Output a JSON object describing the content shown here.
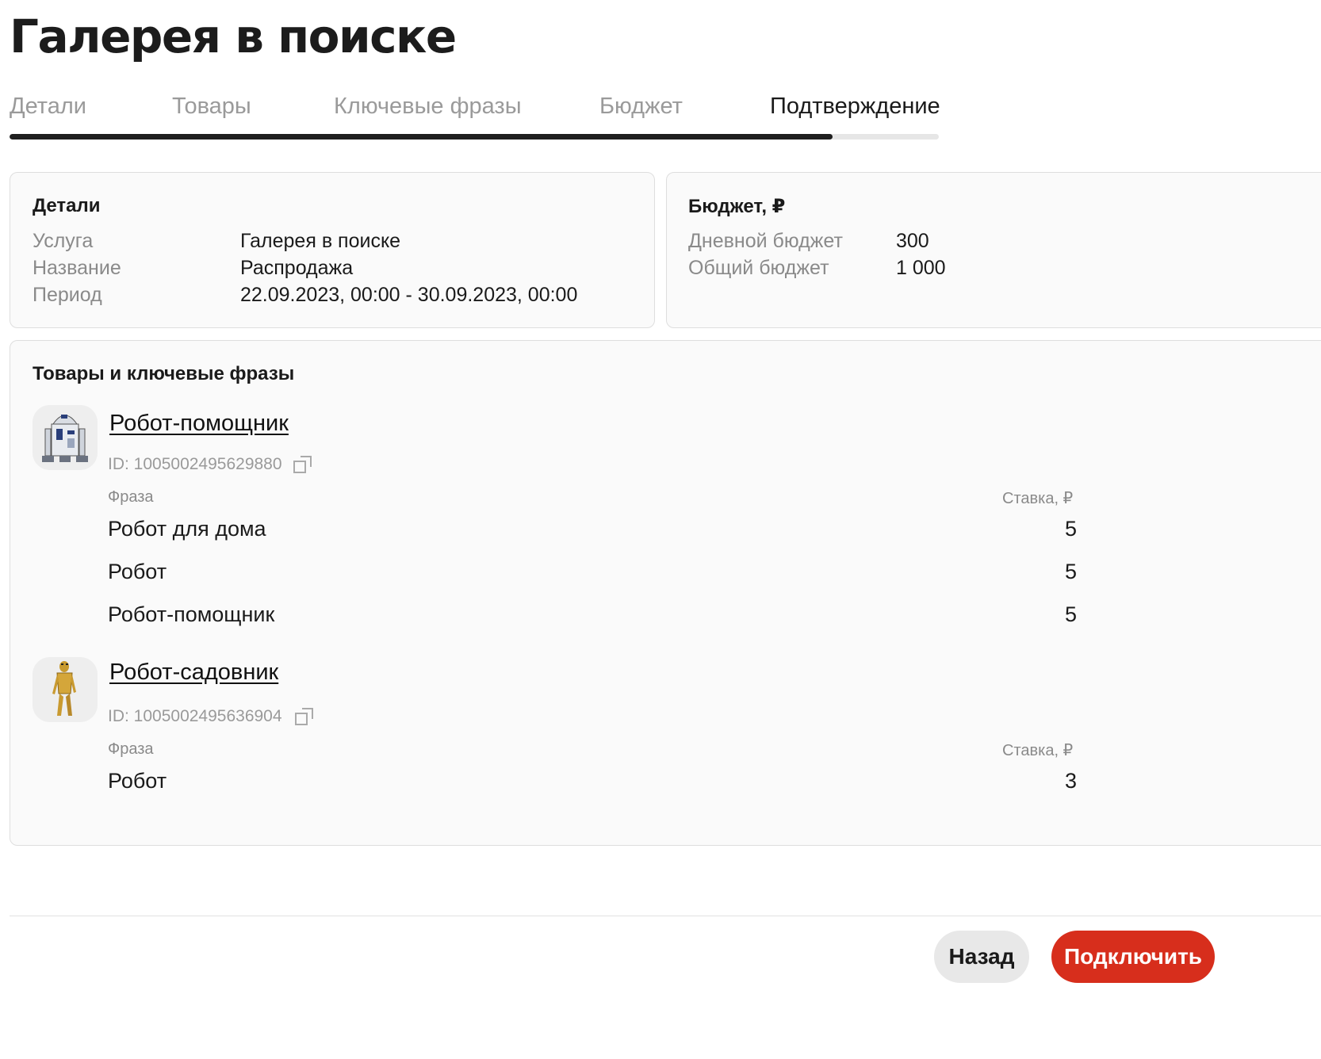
{
  "page": {
    "title": "Галерея в поиске"
  },
  "steps": {
    "items": [
      {
        "label": "Детали"
      },
      {
        "label": "Товары"
      },
      {
        "label": "Ключевые фразы"
      },
      {
        "label": "Бюджет"
      },
      {
        "label": "Подтверждение"
      }
    ],
    "active_index": 4,
    "progress_fraction": 0.886
  },
  "details": {
    "title": "Детали",
    "rows": [
      {
        "label": "Услуга",
        "value": "Галерея в поиске"
      },
      {
        "label": "Название",
        "value": "Распродажа"
      },
      {
        "label": "Период",
        "value": "22.09.2023, 00:00 - 30.09.2023, 00:00"
      }
    ]
  },
  "budget": {
    "title": "Бюджет, ₽",
    "rows": [
      {
        "label": "Дневной бюджет",
        "value": "300"
      },
      {
        "label": "Общий бюджет",
        "value": "1 000"
      }
    ]
  },
  "products": {
    "title": "Товары и ключевые фразы",
    "phrase_header": "Фраза",
    "bid_header": "Ставка, ₽",
    "items": [
      {
        "name": "Робот-помощник",
        "id_text": "ID: 1005002495629880",
        "image_icon": "r2d2-robot-image",
        "phrases": [
          {
            "phrase": "Робот для дома",
            "bid": "5"
          },
          {
            "phrase": "Робот",
            "bid": "5"
          },
          {
            "phrase": "Робот-помощник",
            "bid": "5"
          }
        ]
      },
      {
        "name": "Робот-садовник",
        "id_text": "ID: 1005002495636904",
        "image_icon": "c3po-robot-image",
        "phrases": [
          {
            "phrase": "Робот",
            "bid": "3"
          }
        ]
      }
    ]
  },
  "actions": {
    "back_label": "Назад",
    "connect_label": "Подключить"
  },
  "colors": {
    "accent": "#d72e1c",
    "progress": "#1f1f1f",
    "muted_text": "#8a8a8a"
  }
}
